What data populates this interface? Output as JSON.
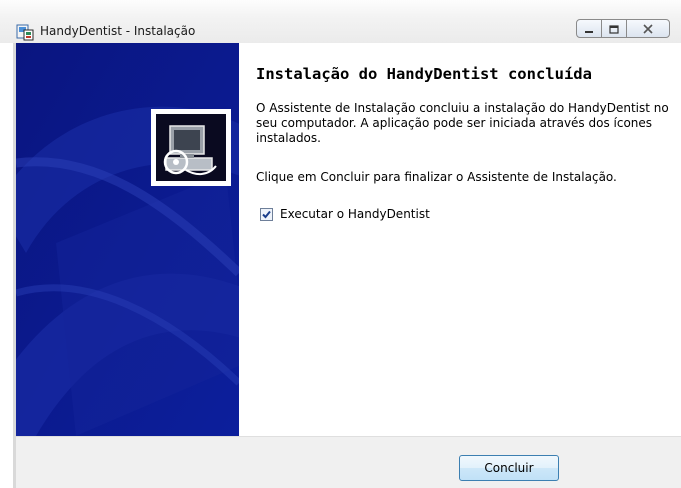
{
  "window": {
    "title": "HandyDentist - Instalação",
    "icon": "installer-icon",
    "controls": {
      "minimize": "minimize-icon",
      "maximize": "maximize-icon",
      "close": "close-icon"
    }
  },
  "banner": {
    "logo": "computer-disk-icon"
  },
  "content": {
    "heading": "Instalação do HandyDentist concluída",
    "paragraph1": "O Assistente de Instalação concluiu a instalação do HandyDentist no seu computador. A aplicação pode ser iniciada através dos ícones instalados.",
    "paragraph2": "Clique em Concluir para finalizar o Assistente de Instalação.",
    "run_checkbox": {
      "label": "Executar o HandyDentist",
      "checked": true
    }
  },
  "footer": {
    "finish_label": "Concluir"
  },
  "colors": {
    "banner": "#0a1a8c",
    "button_border": "#3c7fb1",
    "footer": "#f0f0f0"
  }
}
